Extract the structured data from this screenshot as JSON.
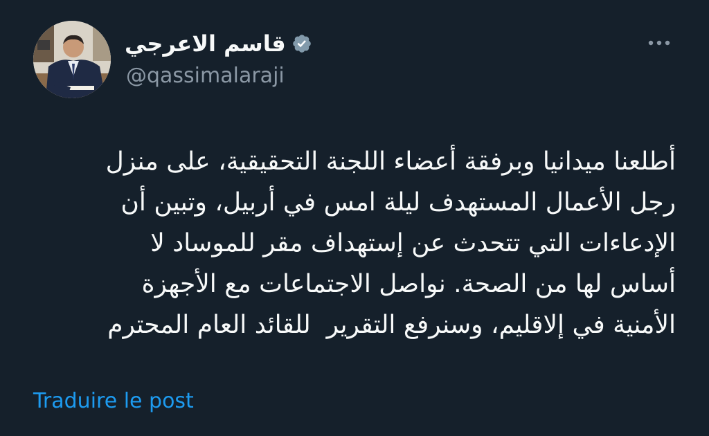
{
  "author": {
    "display_name": "قاسم الاعرجي",
    "handle": "@qassimalaraji",
    "verified": true,
    "avatar_icon": "avatar-photo",
    "verified_icon": "verified-badge-icon"
  },
  "actions": {
    "more_icon": "more-dots-icon"
  },
  "tweet": {
    "text": "أطلعنا ميدانيا وبرفقة أعضاء اللجنة التحقيقية، على منزل\nرجل الأعمال المستهدف ليلة امس في أربيل، وتبين أن\nالإدعاءات التي تتحدث عن إستهداف مقر للموساد لا\nأساس لها من الصحة. نواصل الاجتماعات مع الأجهزة\nالأمنية في إلاقليم، وسنرفع التقرير  للقائد العام المحترم"
  },
  "translate": {
    "label": "Traduire le post"
  },
  "colors": {
    "background": "#15202b",
    "text": "#f7f9f9",
    "secondary": "#8b98a5",
    "link": "#1d9bf0",
    "badge": "#829aab"
  }
}
